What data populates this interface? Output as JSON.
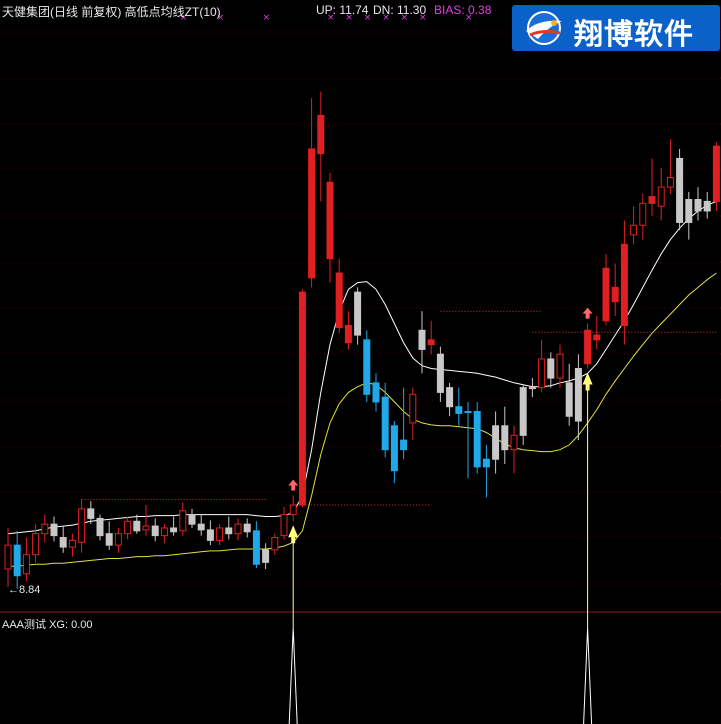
{
  "header": {
    "title": "天健集团(日线 前复权) 高低点均线ZT(10)",
    "up": "UP: 11.74",
    "dn": "DN: 11.30",
    "bias": "BIAS: 0.38"
  },
  "low_label": "8.84",
  "indicator_label": "AAA测试  XG: 0.00",
  "logo": {
    "text": "翔博软件",
    "icon": "eagle-globe-logo"
  },
  "colors": {
    "up_candle": "#e02020",
    "down_candle": "#20a8e8",
    "neutral_candle": "#c8c8c8",
    "band_upper": "#ffffff",
    "band_lower": "#e0e040",
    "resist_dots": "#e03030",
    "signal_arrow": "#ffff80",
    "logo_bg": "#0a62c9",
    "bias_text": "#e040e0"
  },
  "chart_data": {
    "type": "candlestick",
    "title": "天健集团(日线 前复权) 高低点均线ZT(10)",
    "ylim": [
      8.6,
      14.8
    ],
    "grid": true,
    "candles": [
      {
        "o": 9.05,
        "h": 9.48,
        "l": 8.86,
        "c": 9.3,
        "col": "up"
      },
      {
        "o": 9.3,
        "h": 9.45,
        "l": 8.84,
        "c": 8.98,
        "col": "down"
      },
      {
        "o": 9.0,
        "h": 9.38,
        "l": 8.92,
        "c": 9.2,
        "col": "up"
      },
      {
        "o": 9.2,
        "h": 9.52,
        "l": 9.12,
        "c": 9.42,
        "col": "up"
      },
      {
        "o": 9.42,
        "h": 9.62,
        "l": 9.33,
        "c": 9.52,
        "col": "up"
      },
      {
        "o": 9.52,
        "h": 9.6,
        "l": 9.34,
        "c": 9.4,
        "col": "gray"
      },
      {
        "o": 9.38,
        "h": 9.5,
        "l": 9.22,
        "c": 9.28,
        "col": "gray"
      },
      {
        "o": 9.28,
        "h": 9.42,
        "l": 9.18,
        "c": 9.35,
        "col": "up"
      },
      {
        "o": 9.33,
        "h": 9.78,
        "l": 9.22,
        "c": 9.68,
        "col": "up"
      },
      {
        "o": 9.68,
        "h": 9.76,
        "l": 9.52,
        "c": 9.58,
        "col": "gray"
      },
      {
        "o": 9.58,
        "h": 9.62,
        "l": 9.35,
        "c": 9.4,
        "col": "gray"
      },
      {
        "o": 9.42,
        "h": 9.55,
        "l": 9.25,
        "c": 9.3,
        "col": "gray"
      },
      {
        "o": 9.3,
        "h": 9.48,
        "l": 9.22,
        "c": 9.42,
        "col": "up"
      },
      {
        "o": 9.42,
        "h": 9.6,
        "l": 9.36,
        "c": 9.55,
        "col": "up"
      },
      {
        "o": 9.55,
        "h": 9.62,
        "l": 9.42,
        "c": 9.45,
        "col": "gray"
      },
      {
        "o": 9.46,
        "h": 9.72,
        "l": 9.4,
        "c": 9.5,
        "col": "up"
      },
      {
        "o": 9.5,
        "h": 9.58,
        "l": 9.34,
        "c": 9.4,
        "col": "gray"
      },
      {
        "o": 9.4,
        "h": 9.52,
        "l": 9.32,
        "c": 9.48,
        "col": "up"
      },
      {
        "o": 9.48,
        "h": 9.6,
        "l": 9.4,
        "c": 9.44,
        "col": "gray"
      },
      {
        "o": 9.45,
        "h": 9.75,
        "l": 9.4,
        "c": 9.66,
        "col": "up"
      },
      {
        "o": 9.62,
        "h": 9.68,
        "l": 9.48,
        "c": 9.52,
        "col": "gray"
      },
      {
        "o": 9.52,
        "h": 9.62,
        "l": 9.4,
        "c": 9.46,
        "col": "gray"
      },
      {
        "o": 9.46,
        "h": 9.56,
        "l": 9.3,
        "c": 9.35,
        "col": "gray"
      },
      {
        "o": 9.35,
        "h": 9.52,
        "l": 9.3,
        "c": 9.48,
        "col": "up"
      },
      {
        "o": 9.48,
        "h": 9.6,
        "l": 9.36,
        "c": 9.42,
        "col": "gray"
      },
      {
        "o": 9.42,
        "h": 9.58,
        "l": 9.35,
        "c": 9.52,
        "col": "up"
      },
      {
        "o": 9.52,
        "h": 9.58,
        "l": 9.38,
        "c": 9.44,
        "col": "gray"
      },
      {
        "o": 9.45,
        "h": 9.55,
        "l": 9.06,
        "c": 9.1,
        "col": "down"
      },
      {
        "o": 9.12,
        "h": 9.32,
        "l": 9.05,
        "c": 9.25,
        "col": "gray"
      },
      {
        "o": 9.25,
        "h": 9.42,
        "l": 9.2,
        "c": 9.38,
        "col": "up"
      },
      {
        "o": 9.4,
        "h": 9.7,
        "l": 9.36,
        "c": 9.62,
        "col": "up"
      },
      {
        "o": 9.62,
        "h": 9.82,
        "l": 9.55,
        "c": 9.72,
        "col": "up"
      },
      {
        "o": 9.72,
        "h": 11.98,
        "l": 9.7,
        "c": 11.95,
        "col": "up"
      },
      {
        "o": 12.1,
        "h": 13.98,
        "l": 12.0,
        "c": 13.45,
        "col": "up"
      },
      {
        "o": 13.4,
        "h": 14.05,
        "l": 12.9,
        "c": 13.8,
        "col": "up"
      },
      {
        "o": 13.1,
        "h": 13.2,
        "l": 12.05,
        "c": 12.3,
        "col": "up"
      },
      {
        "o": 12.15,
        "h": 12.3,
        "l": 11.52,
        "c": 11.58,
        "col": "up"
      },
      {
        "o": 11.6,
        "h": 11.75,
        "l": 11.35,
        "c": 11.42,
        "col": "up"
      },
      {
        "o": 11.95,
        "h": 12.0,
        "l": 11.4,
        "c": 11.5,
        "col": "gray"
      },
      {
        "o": 11.45,
        "h": 11.55,
        "l": 10.8,
        "c": 10.88,
        "col": "down"
      },
      {
        "o": 11.0,
        "h": 11.1,
        "l": 10.7,
        "c": 10.8,
        "col": "down"
      },
      {
        "o": 10.85,
        "h": 11.0,
        "l": 10.22,
        "c": 10.3,
        "col": "down"
      },
      {
        "o": 10.55,
        "h": 10.6,
        "l": 9.95,
        "c": 10.08,
        "col": "down"
      },
      {
        "o": 10.3,
        "h": 10.95,
        "l": 10.2,
        "c": 10.4,
        "col": "down"
      },
      {
        "o": 10.58,
        "h": 10.95,
        "l": 10.4,
        "c": 10.88,
        "col": "up"
      },
      {
        "o": 11.35,
        "h": 11.75,
        "l": 11.1,
        "c": 11.55,
        "col": "gray"
      },
      {
        "o": 11.45,
        "h": 11.65,
        "l": 11.3,
        "c": 11.4,
        "col": "up"
      },
      {
        "o": 11.3,
        "h": 11.38,
        "l": 10.8,
        "c": 10.9,
        "col": "gray"
      },
      {
        "o": 10.95,
        "h": 11.0,
        "l": 10.65,
        "c": 10.75,
        "col": "gray"
      },
      {
        "o": 10.75,
        "h": 10.95,
        "l": 10.55,
        "c": 10.68,
        "col": "down"
      },
      {
        "o": 10.7,
        "h": 10.8,
        "l": 10.0,
        "c": 10.7,
        "col": "down"
      },
      {
        "o": 10.7,
        "h": 10.8,
        "l": 10.05,
        "c": 10.12,
        "col": "down"
      },
      {
        "o": 10.12,
        "h": 10.35,
        "l": 9.8,
        "c": 10.2,
        "col": "down"
      },
      {
        "o": 10.2,
        "h": 10.7,
        "l": 10.05,
        "c": 10.55,
        "col": "gray"
      },
      {
        "o": 10.55,
        "h": 10.75,
        "l": 10.15,
        "c": 10.3,
        "col": "gray"
      },
      {
        "o": 10.3,
        "h": 10.55,
        "l": 10.05,
        "c": 10.45,
        "col": "up"
      },
      {
        "o": 10.45,
        "h": 10.98,
        "l": 10.35,
        "c": 10.95,
        "col": "gray"
      },
      {
        "o": 10.95,
        "h": 11.05,
        "l": 10.85,
        "c": 10.95,
        "col": "gray"
      },
      {
        "o": 10.95,
        "h": 11.45,
        "l": 10.9,
        "c": 11.25,
        "col": "up"
      },
      {
        "o": 11.25,
        "h": 11.32,
        "l": 10.95,
        "c": 11.05,
        "col": "gray"
      },
      {
        "o": 11.05,
        "h": 11.4,
        "l": 10.95,
        "c": 11.3,
        "col": "up"
      },
      {
        "o": 11.0,
        "h": 11.2,
        "l": 10.55,
        "c": 10.65,
        "col": "gray"
      },
      {
        "o": 10.6,
        "h": 11.3,
        "l": 10.4,
        "c": 11.15,
        "col": "gray"
      },
      {
        "o": 11.2,
        "h": 11.62,
        "l": 11.15,
        "c": 11.55,
        "col": "up"
      },
      {
        "o": 11.5,
        "h": 11.7,
        "l": 11.35,
        "c": 11.45,
        "col": "up"
      },
      {
        "o": 11.65,
        "h": 12.35,
        "l": 11.6,
        "c": 12.2,
        "col": "up"
      },
      {
        "o": 12.0,
        "h": 12.25,
        "l": 11.7,
        "c": 11.85,
        "col": "up"
      },
      {
        "o": 12.45,
        "h": 12.7,
        "l": 11.4,
        "c": 11.6,
        "col": "up"
      },
      {
        "o": 12.55,
        "h": 12.85,
        "l": 12.45,
        "c": 12.65,
        "col": "up"
      },
      {
        "o": 12.65,
        "h": 12.98,
        "l": 12.5,
        "c": 12.88,
        "col": "up"
      },
      {
        "o": 12.95,
        "h": 13.35,
        "l": 12.75,
        "c": 12.88,
        "col": "up"
      },
      {
        "o": 12.85,
        "h": 13.25,
        "l": 12.7,
        "c": 13.05,
        "col": "up"
      },
      {
        "o": 13.05,
        "h": 13.55,
        "l": 12.98,
        "c": 13.15,
        "col": "up"
      },
      {
        "o": 13.35,
        "h": 13.45,
        "l": 12.6,
        "c": 12.68,
        "col": "gray"
      },
      {
        "o": 12.68,
        "h": 13.0,
        "l": 12.5,
        "c": 12.92,
        "col": "gray"
      },
      {
        "o": 12.92,
        "h": 13.05,
        "l": 12.7,
        "c": 12.8,
        "col": "gray"
      },
      {
        "o": 12.8,
        "h": 13.0,
        "l": 12.72,
        "c": 12.9,
        "col": "gray"
      },
      {
        "o": 12.9,
        "h": 13.52,
        "l": 12.8,
        "c": 13.48,
        "col": "up"
      }
    ],
    "upper_band": [
      9.42,
      9.43,
      9.44,
      9.45,
      9.47,
      9.49,
      9.5,
      9.51,
      9.53,
      9.55,
      9.56,
      9.57,
      9.58,
      9.59,
      9.6,
      9.6,
      9.61,
      9.61,
      9.61,
      9.62,
      9.62,
      9.62,
      9.62,
      9.62,
      9.62,
      9.62,
      9.62,
      9.61,
      9.6,
      9.6,
      9.61,
      9.64,
      9.82,
      10.3,
      10.9,
      11.4,
      11.75,
      11.98,
      12.05,
      12.06,
      11.98,
      11.82,
      11.62,
      11.42,
      11.26,
      11.18,
      11.15,
      11.14,
      11.13,
      11.12,
      11.11,
      11.1,
      11.08,
      11.06,
      11.03,
      11.0,
      10.98,
      10.96,
      10.96,
      10.97,
      11.0,
      11.02,
      11.05,
      11.1,
      11.2,
      11.35,
      11.5,
      11.65,
      11.82,
      12.0,
      12.18,
      12.35,
      12.5,
      12.62,
      12.72,
      12.8,
      12.86,
      12.9
    ],
    "lower_band": [
      9.08,
      9.08,
      9.09,
      9.1,
      9.1,
      9.11,
      9.11,
      9.12,
      9.13,
      9.14,
      9.15,
      9.16,
      9.16,
      9.17,
      9.18,
      9.18,
      9.19,
      9.19,
      9.2,
      9.21,
      9.22,
      9.23,
      9.24,
      9.24,
      9.25,
      9.26,
      9.26,
      9.26,
      9.26,
      9.27,
      9.29,
      9.33,
      9.45,
      9.82,
      10.25,
      10.58,
      10.78,
      10.9,
      10.96,
      11.0,
      10.98,
      10.9,
      10.8,
      10.7,
      10.62,
      10.58,
      10.56,
      10.55,
      10.55,
      10.54,
      10.53,
      10.52,
      10.48,
      10.42,
      10.36,
      10.32,
      10.3,
      10.29,
      10.28,
      10.28,
      10.3,
      10.35,
      10.45,
      10.58,
      10.72,
      10.88,
      11.02,
      11.15,
      11.28,
      11.4,
      11.52,
      11.62,
      11.72,
      11.82,
      11.92,
      12.0,
      12.08,
      12.15
    ],
    "resistance_lines": [
      {
        "from": 8,
        "to": 28,
        "price": 9.78
      },
      {
        "from": 31,
        "to": 46,
        "price": 9.72
      },
      {
        "from": 47,
        "to": 58,
        "price": 11.75
      },
      {
        "from": 57,
        "to": 77,
        "price": 11.53
      }
    ],
    "buy_signals": [
      31,
      63
    ],
    "magenta_marks": [
      19,
      23,
      28,
      35,
      37,
      39,
      41,
      43,
      45,
      50,
      56,
      62,
      67,
      73
    ]
  }
}
